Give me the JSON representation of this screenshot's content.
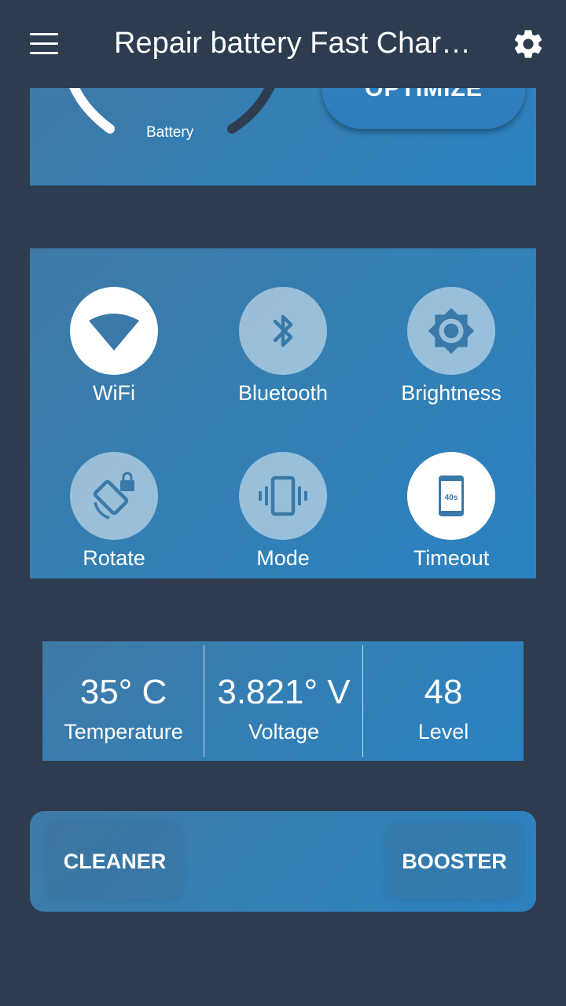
{
  "appbar": {
    "title": "Repair battery Fast Char…",
    "menu_icon": "hamburger-menu-icon",
    "settings_icon": "gear-icon"
  },
  "battery_card": {
    "gauge_label": "Battery",
    "optimize_label": "OPTIMIZE"
  },
  "toggles": [
    {
      "id": "wifi",
      "label": "WiFi",
      "icon": "wifi-icon",
      "active": true
    },
    {
      "id": "bluetooth",
      "label": "Bluetooth",
      "icon": "bluetooth-icon",
      "active": false
    },
    {
      "id": "brightness",
      "label": "Brightness",
      "icon": "brightness-icon",
      "active": false
    },
    {
      "id": "rotate",
      "label": "Rotate",
      "icon": "screen-rotation-lock-icon",
      "active": false
    },
    {
      "id": "mode",
      "label": "Mode",
      "icon": "vibrate-icon",
      "active": false
    },
    {
      "id": "timeout",
      "label": "Timeout",
      "icon": "screen-timeout-icon",
      "active": true,
      "badge": "40s"
    }
  ],
  "stats": [
    {
      "value": "35° C",
      "label": "Temperature"
    },
    {
      "value": "3.821° V",
      "label": "Voltage"
    },
    {
      "value": "48",
      "label": "Level"
    }
  ],
  "actions": {
    "cleaner_label": "CLEANER",
    "booster_label": "BOOSTER"
  },
  "colors": {
    "background": "#2e3c4f",
    "card": "#347fb3",
    "icon_on": "#3a79a8"
  }
}
